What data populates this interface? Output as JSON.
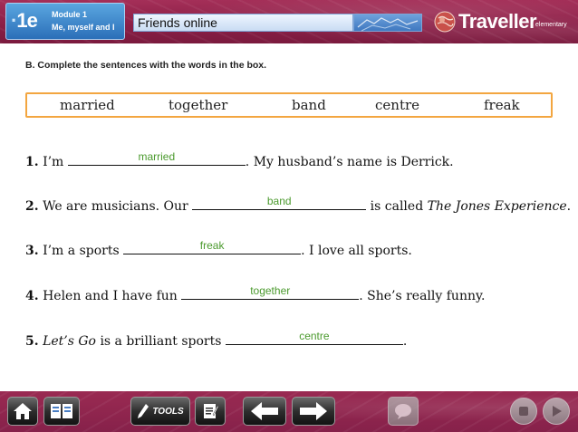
{
  "header": {
    "lesson_number": "1e",
    "module_label": "Module 1",
    "module_title": "Me, myself and I",
    "lesson_title": "Friends online",
    "brand_name": "Traveller",
    "brand_level": "elementary"
  },
  "exercise": {
    "instruction": "B. Complete the sentences with the words in the box.",
    "word_box": [
      "married",
      "together",
      "band",
      "centre",
      "freak"
    ],
    "sentences": [
      {
        "num": "1.",
        "before": "I’m",
        "answer": "married",
        "after": ". My husband’s name is Derrick."
      },
      {
        "num": "2.",
        "before": "We are musicians. Our",
        "answer": "band",
        "after": "is called",
        "after_italic": "The Jones Experience",
        "after_end": "."
      },
      {
        "num": "3.",
        "before": "I’m a sports",
        "answer": "freak",
        "after": ". I love all sports."
      },
      {
        "num": "4.",
        "before": "Helen and I have fun",
        "answer": "together",
        "after": ". She’s really funny."
      },
      {
        "num": "5.",
        "before_italic": "Let’s Go",
        "before": "is a brilliant sports",
        "answer": "centre",
        "after": "."
      }
    ]
  },
  "footer": {
    "tools_label": "TOOLS"
  },
  "colors": {
    "header_bg": "#8c1f47",
    "badge_blue": "#2b6fb8",
    "word_box_border": "#f3a640",
    "answer_green": "#4b9a2e"
  }
}
